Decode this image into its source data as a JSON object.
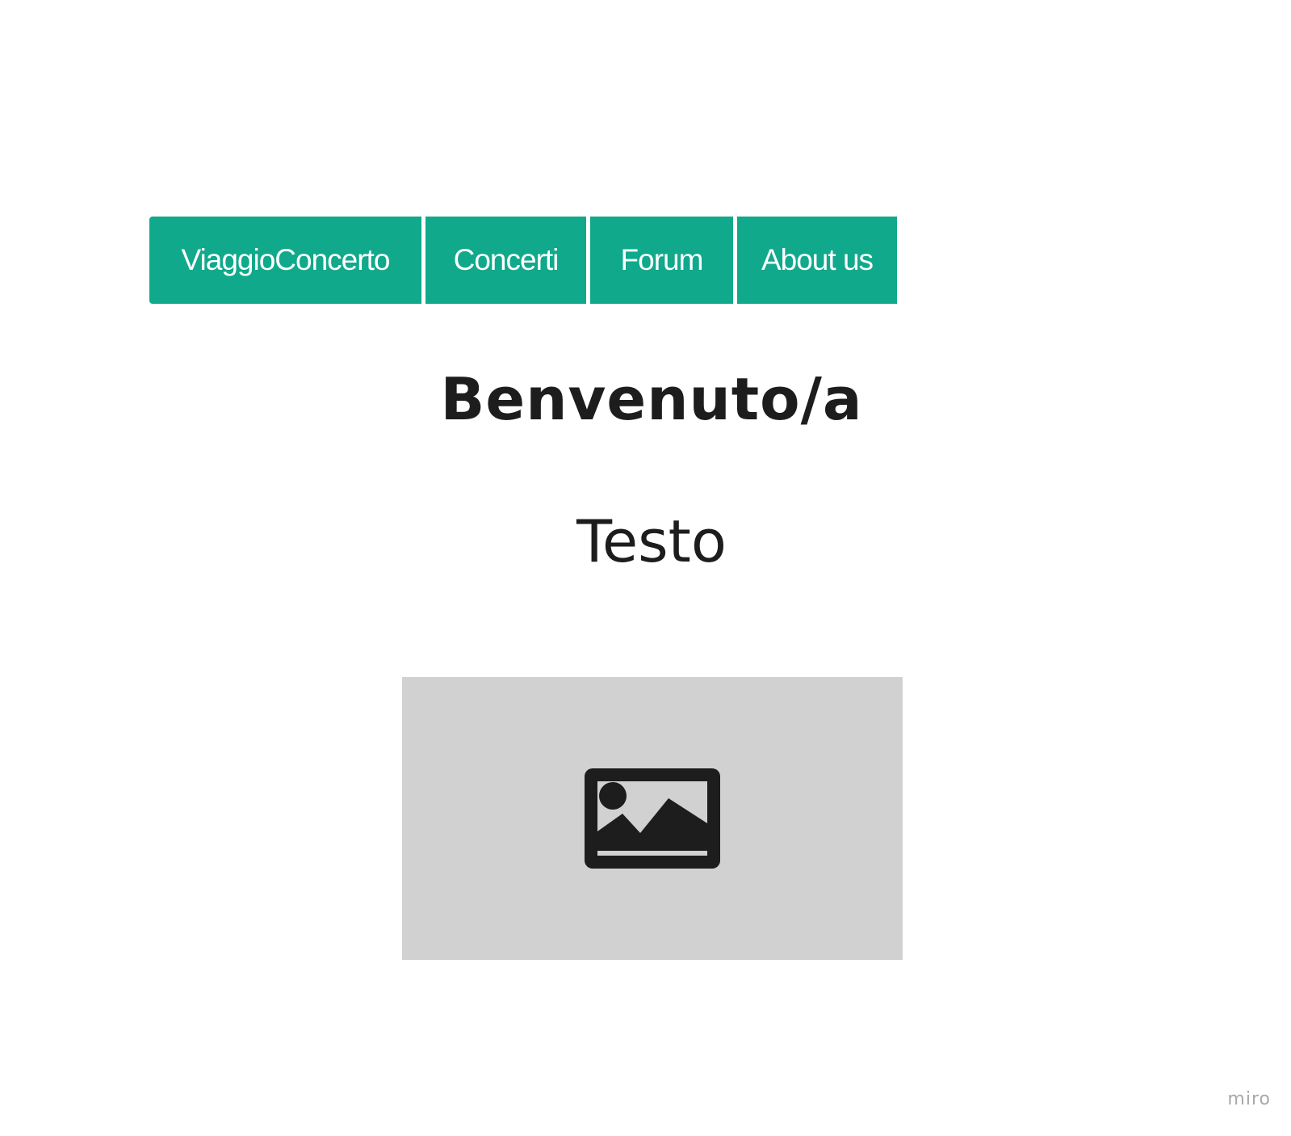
{
  "nav": {
    "items": [
      {
        "label": "ViaggioConcerto"
      },
      {
        "label": "Concerti"
      },
      {
        "label": "Forum"
      },
      {
        "label": "About us"
      }
    ]
  },
  "main": {
    "heading": "Benvenuto/a",
    "text": "Testo",
    "image_icon": "image-icon"
  },
  "watermark": "miro",
  "colors": {
    "nav_background": "#10a98b",
    "nav_text": "#ffffff",
    "heading_text": "#1d1d1d",
    "image_placeholder_bg": "#d1d1d1",
    "image_icon": "#1d1d1d",
    "watermark": "#a8a8a8"
  }
}
